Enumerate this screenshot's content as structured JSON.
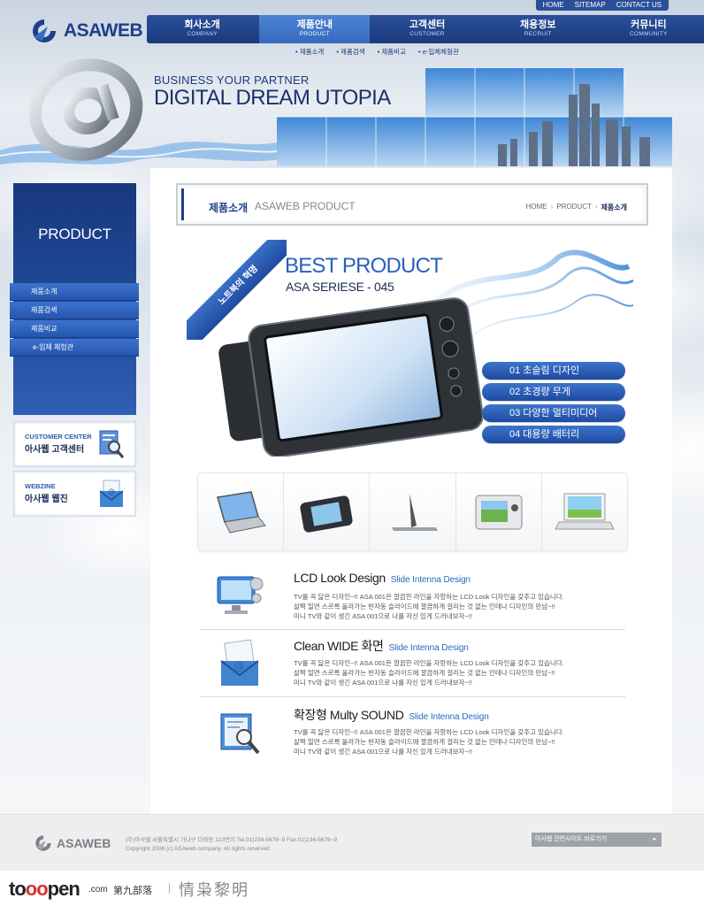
{
  "util_nav": [
    "HOME",
    "SITEMAP",
    "CONTACT US"
  ],
  "logo": {
    "text": "ASAWEB"
  },
  "gnb": [
    {
      "ko": "회사소개",
      "en": "COMPANY"
    },
    {
      "ko": "제품안내",
      "en": "PRODUCT"
    },
    {
      "ko": "고객센터",
      "en": "CUSTOMER"
    },
    {
      "ko": "채용정보",
      "en": "RECRUIT"
    },
    {
      "ko": "커뮤니티",
      "en": "COMMUNITY"
    }
  ],
  "sub_gnb": [
    "제품소개",
    "제품검색",
    "제품비교",
    "e-입체체험관"
  ],
  "banner": {
    "tagline1": "BUSINESS YOUR PARTNER",
    "tagline2": "DIGITAL DREAM UTOPIA"
  },
  "lnb": {
    "title": "PRODUCT",
    "items": [
      "제품소개",
      "제품검색",
      "제품비교",
      "e-입체 체험관"
    ]
  },
  "side_boxes": [
    {
      "en": "CUSTOMER CENTER",
      "ko": "아사웹 고객센터"
    },
    {
      "en": "WEBZINE",
      "ko": "아사웹 웹진"
    }
  ],
  "title_bar": {
    "ko": "제품소개",
    "en": "ASAWEB PRODUCT",
    "breadcrumb": [
      "HOME",
      "PRODUCT",
      "제품소개"
    ]
  },
  "hero": {
    "ribbon": "노트북의 혁명",
    "title": "BEST PRODUCT",
    "series": "ASA SERIESE - 045",
    "features": [
      "01 초슬림 디자인",
      "02 초경량 무게",
      "03 다양한 멀티미디어",
      "04 대용량 배터리"
    ]
  },
  "thumbnails": [
    "laptop-open",
    "portable-player",
    "laptop-side",
    "camera",
    "laptop-white"
  ],
  "feature_rows": [
    {
      "title": "LCD  Look Design",
      "subtitle": "Slide Intenna Design",
      "lines": [
        "TV를 꼭 닮은 디자인~!! ASA 001은 깔끔한 라인을 자랑하는 LCD Look 디자인을 갖추고 있습니다.",
        "살짝 밀면 스르륵 올라가는 반자동 슬라이드에 깔끔하게 걸리는 것 없는 인테나 디자인의 만남~!!",
        "미니 TV와 같이 생긴 ASA 001으로 나를 자신 있게 드러내보자~!!"
      ],
      "icon": "monitor-icon"
    },
    {
      "title": "Clean WIDE 화면",
      "subtitle": "Slide Intenna Design",
      "lines": [
        "TV를 꼭 닮은 디자인~!! ASA 001은 깔끔한 라인을 자랑하는 LCD Look 디자인을 갖추고 있습니다.",
        "살짝 밀면 스르륵 올라가는 반자동 슬라이드에 깔끔하게 걸리는 것 없는 인테나 디자인의 만남~!!",
        "미니 TV와 같이 생긴 ASA 001으로 나를 자신 있게 드러내보자~!!"
      ],
      "icon": "mail-icon"
    },
    {
      "title": "확장형 Multy SOUND",
      "subtitle": "Slide Intenna Design",
      "lines": [
        "TV를 꼭 닮은 디자인~!! ASA 001은 깔끔한 라인을 자랑하는 LCD Look 디자인을 갖추고 있습니다.",
        "살짝 밀면 스르륵 올라가는 반자동 슬라이드에 깔끔하게 걸리는 것 없는 인테나 디자인의 만남~!!",
        "미니 TV와 같이 생긴 ASA 001으로 나를 자신 있게 드러내보자~!!"
      ],
      "icon": "search-document-icon"
    }
  ],
  "footer": {
    "logo": "ASAWEB",
    "address": "(주)아사웹 서울특별시 가나구 다라동 123번지  Tel.01)234-5678~9  Fax.01)234-5678~9",
    "copyright": "Copyright 2008 (c) ASAweb company. All rights reserved",
    "family_site": "아사웹 관련사이트 바로가기",
    "family_arrow": "▸"
  },
  "watermark": {
    "brand_a": "to",
    "brand_b": "oo",
    "brand_c": "pen",
    "com": ".com",
    "cn": "第九部落",
    "sep": "|",
    "name": "情枭黎明"
  },
  "colors": {
    "primary": "#1f3f8a",
    "accent": "#3c74cc",
    "footer_bg": "#eeeeef"
  }
}
